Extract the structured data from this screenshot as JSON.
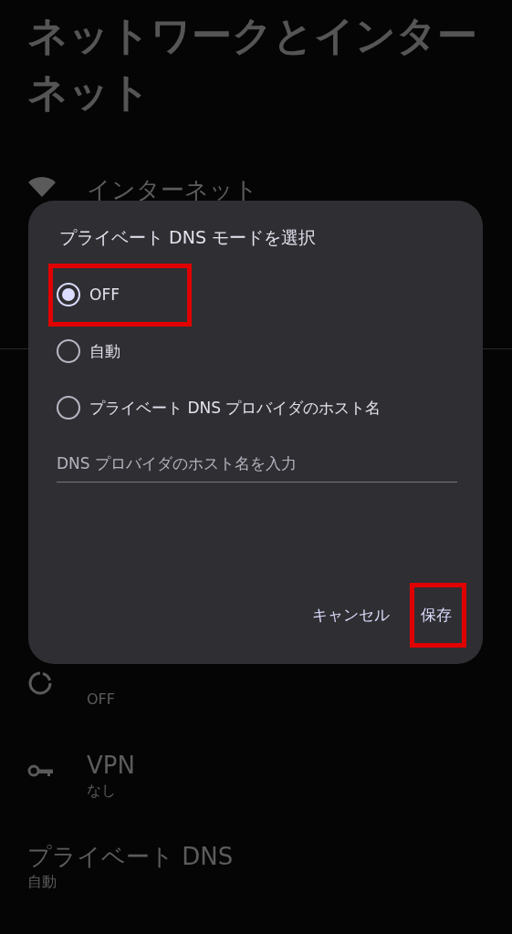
{
  "page": {
    "title": "ネットワークとインターネット"
  },
  "settings": [
    {
      "kind": "wifi",
      "title": "インターネット"
    },
    {
      "kind": "divider"
    },
    {
      "kind": "saver",
      "summary": "OFF"
    },
    {
      "kind": "key",
      "title": "VPN",
      "summary": "なし"
    },
    {
      "kind": "plain",
      "title": "プライベート DNS",
      "summary": "自動"
    }
  ],
  "dialog": {
    "title": "プライベート DNS モードを選択",
    "options": [
      {
        "label": "OFF",
        "selected": true,
        "highlighted": true
      },
      {
        "label": "自動",
        "selected": false,
        "highlighted": false
      },
      {
        "label": "プライベート DNS プロバイダのホスト名",
        "selected": false,
        "highlighted": false
      }
    ],
    "hostname_field": {
      "placeholder": "DNS プロバイダのホスト名を入力"
    },
    "buttons": [
      {
        "label": "キャンセル",
        "highlighted": false
      },
      {
        "label": "保存",
        "highlighted": true
      }
    ]
  }
}
